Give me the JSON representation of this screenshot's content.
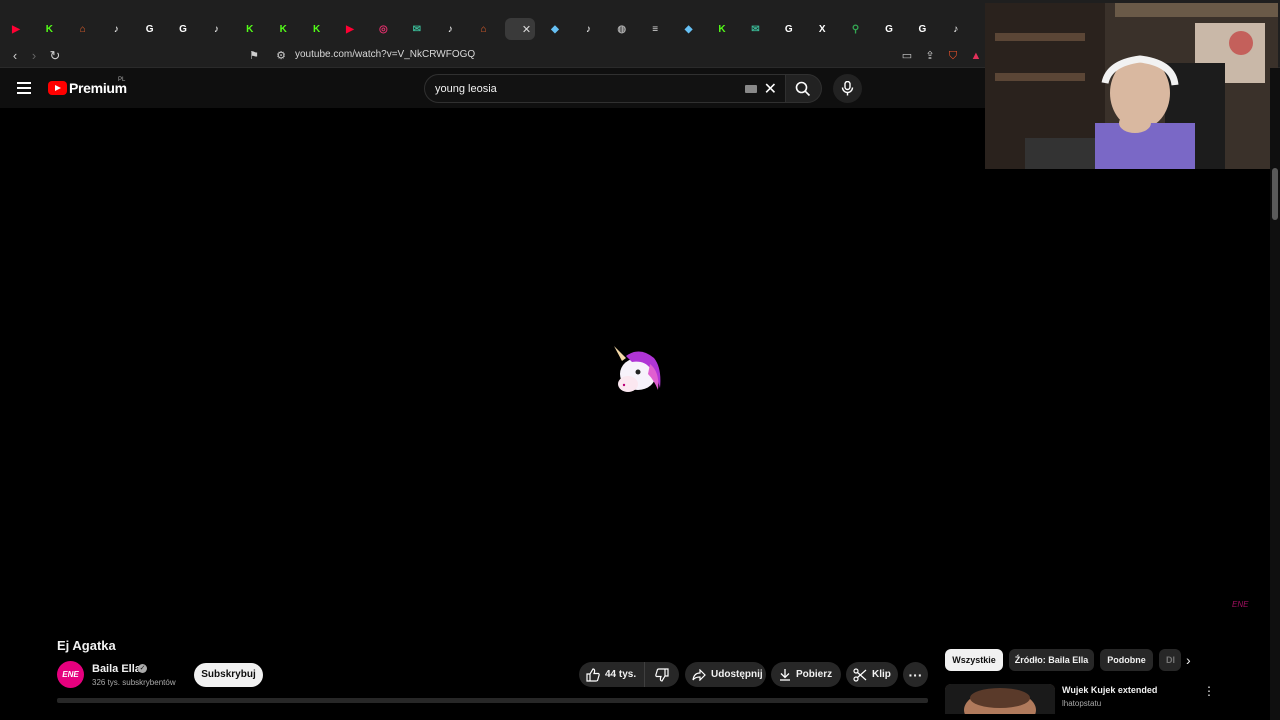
{
  "browser": {
    "tabs": [
      {
        "icon": "youtube-icon",
        "color": "#ff0033",
        "glyph": "▶"
      },
      {
        "icon": "kick-icon",
        "color": "#53fc18",
        "glyph": "K"
      },
      {
        "icon": "home-icon",
        "color": "#e8622c",
        "glyph": "⌂"
      },
      {
        "icon": "tiktok-icon",
        "color": "#ffffff",
        "glyph": "♪"
      },
      {
        "icon": "google-icon",
        "color": "#ffffff",
        "glyph": "G"
      },
      {
        "icon": "google-icon",
        "color": "#ffffff",
        "glyph": "G"
      },
      {
        "icon": "tiktok-icon",
        "color": "#ffffff",
        "glyph": "♪"
      },
      {
        "icon": "kick-icon",
        "color": "#53fc18",
        "glyph": "K"
      },
      {
        "icon": "kick-icon",
        "color": "#53fc18",
        "glyph": "K"
      },
      {
        "icon": "kick-icon",
        "color": "#53fc18",
        "glyph": "K"
      },
      {
        "icon": "youtube-icon",
        "color": "#ff0033",
        "glyph": "▶"
      },
      {
        "icon": "instagram-icon",
        "color": "#e1306c",
        "glyph": "◎"
      },
      {
        "icon": "chat-icon",
        "color": "#3ab795",
        "glyph": "✉"
      },
      {
        "icon": "tiktok-icon",
        "color": "#ffffff",
        "glyph": "♪"
      },
      {
        "icon": "home-icon",
        "color": "#e8622c",
        "glyph": "⌂"
      },
      {
        "icon": "active-tab-icon",
        "color": "#cccccc",
        "glyph": "",
        "active": true
      },
      {
        "icon": "steam-icon",
        "color": "#66c0f4",
        "glyph": "◆"
      },
      {
        "icon": "tiktok-icon",
        "color": "#ffffff",
        "glyph": "♪"
      },
      {
        "icon": "globe-icon",
        "color": "#aaaaaa",
        "glyph": "◍"
      },
      {
        "icon": "database-icon",
        "color": "#dddddd",
        "glyph": "≡"
      },
      {
        "icon": "steam-icon",
        "color": "#66c0f4",
        "glyph": "◆"
      },
      {
        "icon": "kick-icon",
        "color": "#53fc18",
        "glyph": "K"
      },
      {
        "icon": "chat-icon",
        "color": "#3ab795",
        "glyph": "✉"
      },
      {
        "icon": "google-icon",
        "color": "#ffffff",
        "glyph": "G"
      },
      {
        "icon": "x-icon",
        "color": "#ffffff",
        "glyph": "X"
      },
      {
        "icon": "maps-icon",
        "color": "#34a853",
        "glyph": "⚲"
      },
      {
        "icon": "google-icon",
        "color": "#ffffff",
        "glyph": "G"
      },
      {
        "icon": "google-icon",
        "color": "#ffffff",
        "glyph": "G"
      },
      {
        "icon": "tiktok-icon",
        "color": "#ffffff",
        "glyph": "♪"
      }
    ],
    "url": "youtube.com/watch?v=V_NkCRWFOGQ"
  },
  "youtube": {
    "brand": "Premium",
    "country": "PL",
    "search_query": "young leosia"
  },
  "video": {
    "title": "Ej Agatka",
    "watermark": "ENE"
  },
  "channel": {
    "name": "Baila Ella",
    "subscribers": "326 tys. subskrybentów",
    "avatar_text": "ENE",
    "subscribe_label": "Subskrybuj"
  },
  "actions": {
    "likes": "44 tys.",
    "share": "Udostępnij",
    "download": "Pobierz",
    "clip": "Klip",
    "more": "···"
  },
  "chips": [
    "Wszystkie",
    "Źródło: Baila Ella",
    "Podobne",
    "Dl"
  ],
  "recommendation": {
    "title": "Wujek Kujek extended",
    "channel": "lhatopstatu"
  },
  "colors": {
    "accent": "#ff0000",
    "background": "#0f0f0f",
    "channel_pink": "#e6007e"
  }
}
